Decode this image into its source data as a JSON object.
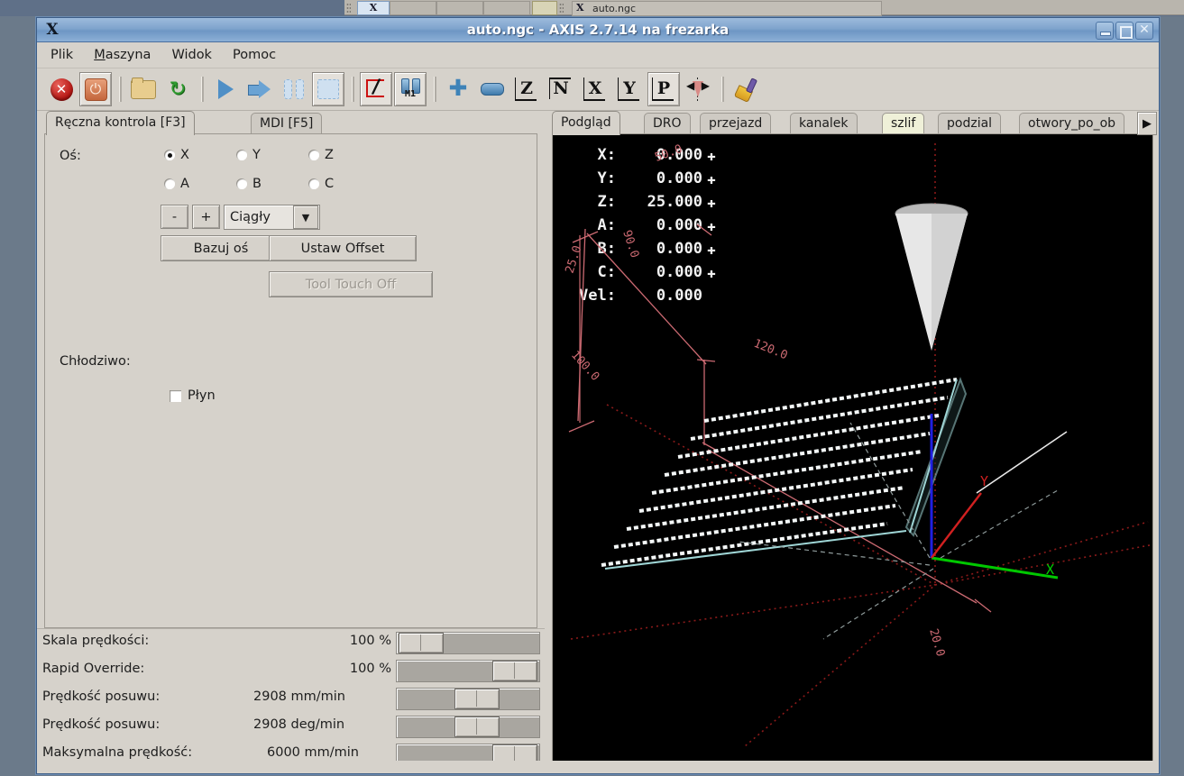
{
  "taskbar": {
    "app_item_label": "auto.ngc"
  },
  "window": {
    "title": "auto.ngc - AXIS 2.7.14 na frezarka",
    "app_icon": "x-logo-icon",
    "minimize_label": "–",
    "maximize_label": "□",
    "close_label": "✕"
  },
  "menubar": {
    "items": [
      {
        "label": "Plik",
        "mnemonic": ""
      },
      {
        "label": "Maszyna",
        "mnemonic": "M"
      },
      {
        "label": "Widok",
        "mnemonic": ""
      },
      {
        "label": "Pomoc",
        "mnemonic": ""
      }
    ]
  },
  "toolbar": {
    "buttons": [
      {
        "name": "estop-button",
        "icon": "estop-icon",
        "pressed": false
      },
      {
        "name": "machine-power-button",
        "icon": "power-icon",
        "pressed": true
      },
      {
        "name": "open-file-button",
        "icon": "folder-open-icon",
        "pressed": false
      },
      {
        "name": "reload-file-button",
        "icon": "reload-icon",
        "pressed": false
      },
      {
        "name": "run-program-button",
        "icon": "play-icon",
        "pressed": false
      },
      {
        "name": "step-button",
        "icon": "step-arrow-icon",
        "pressed": false
      },
      {
        "name": "pause-button",
        "icon": "pause-icon",
        "pressed": false
      },
      {
        "name": "stop-button",
        "icon": "stop-icon",
        "pressed": false
      },
      {
        "name": "skip-block-button",
        "icon": "block-delete-icon",
        "pressed": false
      },
      {
        "name": "optional-stop-button",
        "icon": "m1-optional-stop-icon",
        "pressed": true
      },
      {
        "name": "zoom-in-button",
        "icon": "plus-icon",
        "pressed": false
      },
      {
        "name": "zoom-out-button",
        "icon": "minus-icon",
        "pressed": false
      },
      {
        "name": "view-z-button",
        "icon": "view-z-icon",
        "label": "Z",
        "pressed": false
      },
      {
        "name": "view-z2-button",
        "icon": "view-z2-icon",
        "label": "N",
        "pressed": false
      },
      {
        "name": "view-x-button",
        "icon": "view-x-icon",
        "label": "X",
        "pressed": false
      },
      {
        "name": "view-y-button",
        "icon": "view-y-icon",
        "label": "Y",
        "pressed": false
      },
      {
        "name": "view-p-button",
        "icon": "view-p-icon",
        "label": "P",
        "pressed": true
      },
      {
        "name": "show-tool-button",
        "icon": "tool-cone-icon",
        "pressed": false
      },
      {
        "name": "clear-plot-button",
        "icon": "broom-icon",
        "pressed": false
      }
    ]
  },
  "left_panel": {
    "tabs": [
      {
        "label": "Ręczna kontrola [F3]",
        "active": true
      },
      {
        "label": "MDI [F5]",
        "active": false
      }
    ],
    "manual": {
      "axis_label": "Oś:",
      "axes": [
        {
          "label": "X",
          "selected": true
        },
        {
          "label": "Y",
          "selected": false
        },
        {
          "label": "Z",
          "selected": false
        },
        {
          "label": "A",
          "selected": false
        },
        {
          "label": "B",
          "selected": false
        },
        {
          "label": "C",
          "selected": false
        }
      ],
      "jog_minus": "-",
      "jog_plus": "+",
      "increment_value": "Ciągły",
      "home_button": "Bazuj oś",
      "offset_button": "Ustaw Offset",
      "tool_touch_off_button": "Tool Touch Off",
      "coolant_label": "Chłodziwo:",
      "flood_label": "Płyn",
      "flood_checked": false
    },
    "sliders": [
      {
        "name": "feed-override",
        "label": "Skala prędkości:",
        "value": "100 %",
        "thumb_pct": 11
      },
      {
        "name": "rapid-override",
        "label": "Rapid Override:",
        "value": "100 %",
        "thumb_pct": 68
      },
      {
        "name": "jog-speed-linear",
        "label": "Prędkość posuwu:",
        "value": "2908 mm/min",
        "thumb_pct": 43
      },
      {
        "name": "jog-speed-angular",
        "label": "Prędkość posuwu:",
        "value": "2908 deg/min",
        "thumb_pct": 43
      },
      {
        "name": "max-velocity",
        "label": "Maksymalna prędkość:",
        "value": "6000 mm/min",
        "thumb_pct": 68
      }
    ]
  },
  "right_panel": {
    "tabs": [
      {
        "label": "Podgląd",
        "active": true,
        "highlight": false
      },
      {
        "label": "DRO",
        "active": false,
        "highlight": false
      },
      {
        "label": "przejazd",
        "active": false,
        "highlight": false
      },
      {
        "label": "kanalek",
        "active": false,
        "highlight": false
      },
      {
        "label": "szlif",
        "active": false,
        "highlight": true
      },
      {
        "label": "podzial",
        "active": false,
        "highlight": false
      },
      {
        "label": "otwory_po_ob",
        "active": false,
        "highlight": false
      }
    ],
    "scroll_arrow": "▶",
    "dro": [
      {
        "axis": "X:",
        "value": "0.000",
        "homed": true
      },
      {
        "axis": "Y:",
        "value": "0.000",
        "homed": true
      },
      {
        "axis": "Z:",
        "value": "25.000",
        "homed": true
      },
      {
        "axis": "A:",
        "value": "0.000",
        "homed": true
      },
      {
        "axis": "B:",
        "value": "0.000",
        "homed": true
      },
      {
        "axis": "C:",
        "value": "0.000",
        "homed": true
      },
      {
        "axis": "Vel:",
        "value": "0.000",
        "homed": false
      }
    ],
    "extents": [
      {
        "name": "extent-50",
        "label": "50.0"
      },
      {
        "name": "extent-90",
        "label": "90.0"
      },
      {
        "name": "extent-25",
        "label": "25.0"
      },
      {
        "name": "extent-100",
        "label": "100.0"
      },
      {
        "name": "extent-120",
        "label": "120.0"
      },
      {
        "name": "extent-20",
        "label": "20.0"
      }
    ],
    "axis_markers": [
      {
        "name": "x-axis-marker",
        "label": "X",
        "color": "#00d000"
      },
      {
        "name": "y-axis-marker",
        "label": "Y",
        "color": "#d02020"
      }
    ]
  },
  "colors": {
    "window_bg": "#d6d2cb",
    "titlebar": "#7fa4cd",
    "preview_bg": "#000000",
    "toolpath": "#ffffff",
    "extents": "#cc6a72",
    "limits": "#8b1a1a",
    "tab_highlight": "#eff0d8",
    "x_axis": "#00d000",
    "y_axis": "#d02020",
    "z_axis": "#2020e0"
  }
}
